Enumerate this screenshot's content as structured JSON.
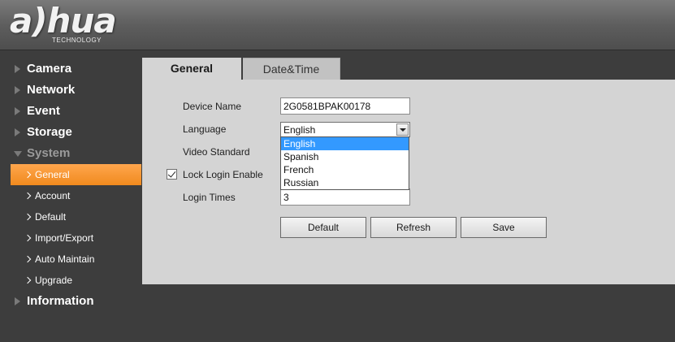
{
  "brand": {
    "logo_text": "a)hua",
    "tagline": "TECHNOLOGY"
  },
  "sidebar": {
    "items": [
      {
        "label": "Camera"
      },
      {
        "label": "Network"
      },
      {
        "label": "Event"
      },
      {
        "label": "Storage"
      },
      {
        "label": "System",
        "expanded": true
      }
    ],
    "system_subitems": [
      {
        "label": "General",
        "active": true
      },
      {
        "label": "Account"
      },
      {
        "label": "Default"
      },
      {
        "label": "Import/Export"
      },
      {
        "label": "Auto Maintain"
      },
      {
        "label": "Upgrade"
      }
    ],
    "bottom_item": {
      "label": "Information"
    }
  },
  "tabs": [
    {
      "label": "General",
      "active": true
    },
    {
      "label": "Date&Time"
    }
  ],
  "form": {
    "device_name_label": "Device Name",
    "device_name_value": "2G0581BPAK00178",
    "language_label": "Language",
    "language_value": "English",
    "language_options": [
      "English",
      "Spanish",
      "French",
      "Russian"
    ],
    "video_standard_label": "Video Standard",
    "lock_login_label": "Lock Login Enable",
    "lock_login_checked": true,
    "login_times_label": "Login Times",
    "login_times_value": "3"
  },
  "buttons": {
    "default_label": "Default",
    "refresh_label": "Refresh",
    "save_label": "Save"
  },
  "colors": {
    "accent": "#f08a1e",
    "selection": "#3399ff",
    "panel": "#d4d4d4",
    "background": "#3d3d3d"
  }
}
